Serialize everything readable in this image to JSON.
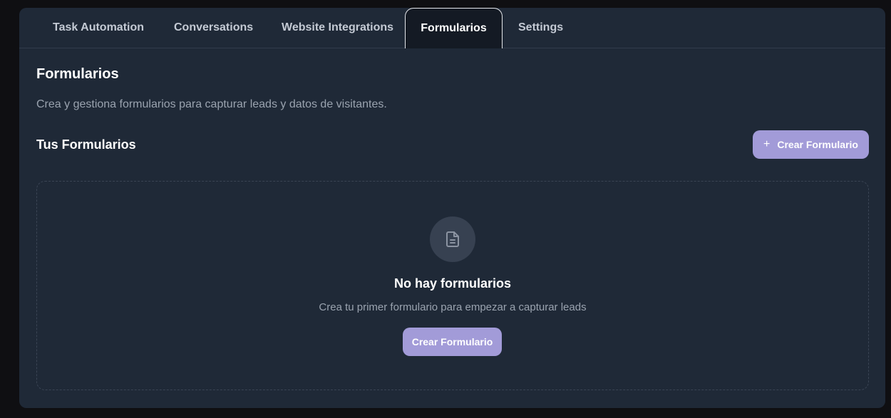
{
  "tabs": [
    {
      "label": "Task Automation"
    },
    {
      "label": "Conversations"
    },
    {
      "label": "Website Integrations"
    },
    {
      "label": "Formularios",
      "active": true
    },
    {
      "label": "Settings"
    }
  ],
  "page": {
    "title": "Formularios",
    "subtitle": "Crea y gestiona formularios para capturar leads y datos de visitantes."
  },
  "forms_section": {
    "title": "Tus Formularios",
    "create_button_label": "Crear Formulario",
    "create_button_icon": "plus-icon"
  },
  "empty_state": {
    "icon": "file-text-icon",
    "title": "No hay formularios",
    "text": "Crea tu primer formulario para empezar a capturar leads",
    "button_label": "Crear Formulario"
  },
  "colors": {
    "background": "#0f0f12",
    "panel": "#1f2937",
    "active_tab": "#141a24",
    "accent_button": "#a29bd8",
    "muted_text": "#9aa3af"
  }
}
